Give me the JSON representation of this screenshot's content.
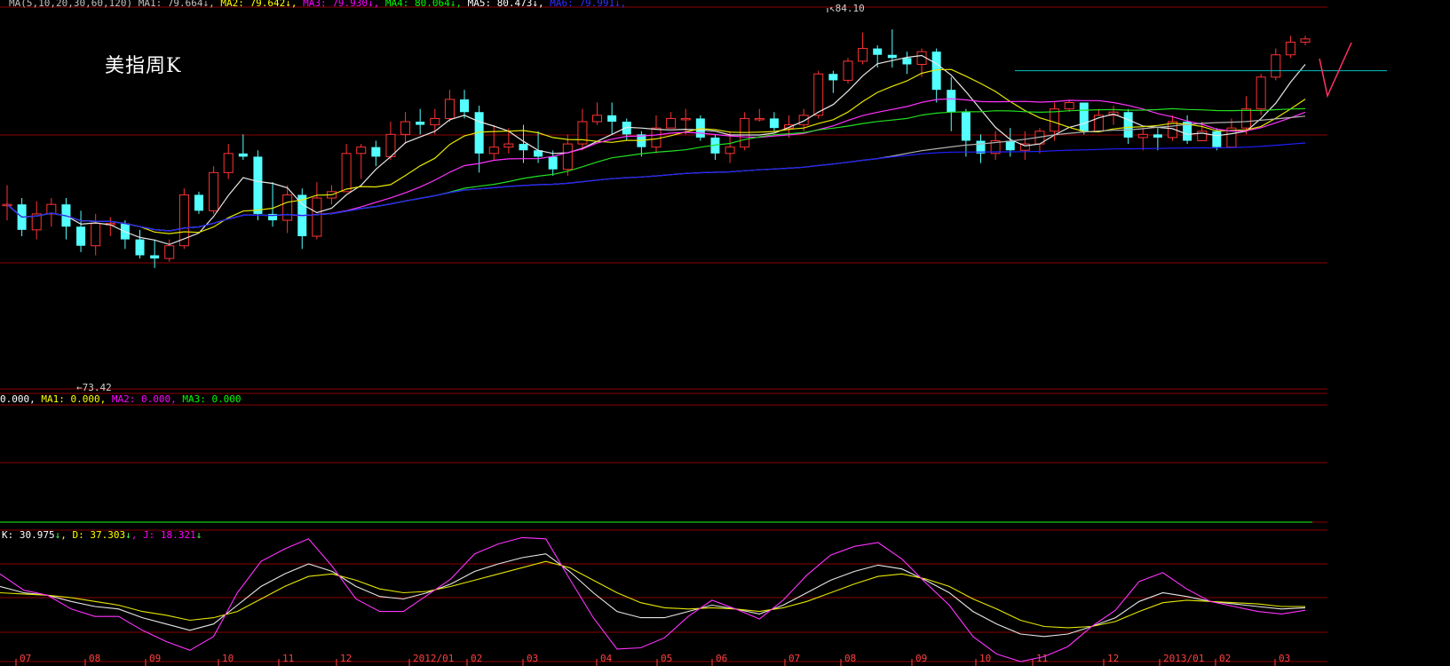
{
  "title": "美指周K",
  "price_panel_header": {
    "items": [
      {
        "label": "MA(5,10,20,30,60,120) MA1: ",
        "value": "79.664",
        "color": "#c0c0c0"
      },
      {
        "label": " MA2: ",
        "value": "79.642",
        "color": "#ffff00"
      },
      {
        "label": " MA3: ",
        "value": "79.930",
        "color": "#ff00ff"
      },
      {
        "label": " MA4: ",
        "value": "80.064",
        "color": "#00ff00"
      },
      {
        "label": " MA5: ",
        "value": "80.473",
        "color": "#ffffff"
      },
      {
        "label": " MA6: ",
        "value": "79.991",
        "color": "#3030ff"
      }
    ]
  },
  "volume_panel_header": {
    "prefix": "0.000, ",
    "ma1": "MA1: 0.000, ",
    "ma2": "MA2: 0.000, ",
    "ma3": "MA3: 0.000"
  },
  "kdj_panel_header": {
    "k": "K: 30.975",
    "d": "D: 37.303",
    "j": "J: 18.321",
    "arrow": "↓"
  },
  "annotations": {
    "high": "84.10",
    "low": "73.42"
  },
  "x_ticks": [
    "07",
    "08",
    "09",
    "10",
    "11",
    "12",
    "2012/01",
    "02",
    "03",
    "04",
    "05",
    "06",
    "07",
    "08",
    "09",
    "10",
    "11",
    "12",
    "2013/01",
    "02",
    "03"
  ],
  "colors": {
    "background": "#000000",
    "up": "#ff3333",
    "down": "#54ffff",
    "grid": "#8b0000",
    "ma_white": "#e6e6e6",
    "ma_yellow": "#e6e600",
    "ma_magenta": "#ff33ff",
    "ma_green": "#22dd22",
    "ma_gray": "#b0b0b0",
    "ma_blue": "#2020ff",
    "resistance": "#00c0c0"
  },
  "chart_data": {
    "type": "candlestick",
    "interval": "weekly",
    "ylim": [
      72.8,
      84.8
    ],
    "candles": [
      [
        78.6,
        78.6,
        79.2,
        78.1
      ],
      [
        78.6,
        77.8,
        78.8,
        77.6
      ],
      [
        77.8,
        78.3,
        78.7,
        77.5
      ],
      [
        78.3,
        78.6,
        78.8,
        77.9
      ],
      [
        78.6,
        77.9,
        78.8,
        77.5
      ],
      [
        77.9,
        77.3,
        78.4,
        77.1
      ],
      [
        77.3,
        78.0,
        78.3,
        77.0
      ],
      [
        78.0,
        78.0,
        78.2,
        77.6
      ],
      [
        78.0,
        77.5,
        78.1,
        77.2
      ],
      [
        77.5,
        77.0,
        77.8,
        76.9
      ],
      [
        77.0,
        76.9,
        77.5,
        76.6
      ],
      [
        76.9,
        77.3,
        77.5,
        76.8
      ],
      [
        77.3,
        78.9,
        79.1,
        77.2
      ],
      [
        78.9,
        78.4,
        79.0,
        78.3
      ],
      [
        78.4,
        79.6,
        79.8,
        78.3
      ],
      [
        79.6,
        80.2,
        80.5,
        79.4
      ],
      [
        80.2,
        80.1,
        80.8,
        80.0
      ],
      [
        80.1,
        78.3,
        80.3,
        78.1
      ],
      [
        78.3,
        78.1,
        79.3,
        77.9
      ],
      [
        78.1,
        78.9,
        79.2,
        77.7
      ],
      [
        78.9,
        77.6,
        79.1,
        77.2
      ],
      [
        77.6,
        78.8,
        79.3,
        77.5
      ],
      [
        78.8,
        79.0,
        79.2,
        78.6
      ],
      [
        79.0,
        80.2,
        80.5,
        79.1
      ],
      [
        80.2,
        80.4,
        80.5,
        79.4
      ],
      [
        80.4,
        80.1,
        80.6,
        79.8
      ],
      [
        80.1,
        80.8,
        81.2,
        80.0
      ],
      [
        80.8,
        81.2,
        81.5,
        80.5
      ],
      [
        81.2,
        81.1,
        81.6,
        80.8
      ],
      [
        81.1,
        81.3,
        81.6,
        80.8
      ],
      [
        81.3,
        81.9,
        82.2,
        81.2
      ],
      [
        81.9,
        81.5,
        82.2,
        81.3
      ],
      [
        81.5,
        80.2,
        81.7,
        79.6
      ],
      [
        80.2,
        80.4,
        81.1,
        80.0
      ],
      [
        80.4,
        80.5,
        81.0,
        80.2
      ],
      [
        80.5,
        80.3,
        81.1,
        79.9
      ],
      [
        80.3,
        80.1,
        80.9,
        79.9
      ],
      [
        80.1,
        79.7,
        80.3,
        79.5
      ],
      [
        79.7,
        80.5,
        80.8,
        79.5
      ],
      [
        80.5,
        81.2,
        81.6,
        80.3
      ],
      [
        81.2,
        81.4,
        81.8,
        81.1
      ],
      [
        81.4,
        81.2,
        81.8,
        80.8
      ],
      [
        81.2,
        80.8,
        81.3,
        80.6
      ],
      [
        80.8,
        80.4,
        80.9,
        80.1
      ],
      [
        80.4,
        81.0,
        81.4,
        80.2
      ],
      [
        81.0,
        81.3,
        81.5,
        81.0
      ],
      [
        81.3,
        81.3,
        81.6,
        80.8
      ],
      [
        81.3,
        80.7,
        81.4,
        80.6
      ],
      [
        80.7,
        80.2,
        80.8,
        80.0
      ],
      [
        80.2,
        80.4,
        80.9,
        79.9
      ],
      [
        80.4,
        81.3,
        81.5,
        80.3
      ],
      [
        81.3,
        81.3,
        81.6,
        81.2
      ],
      [
        81.3,
        81.0,
        81.5,
        80.9
      ],
      [
        81.0,
        81.1,
        81.4,
        80.7
      ],
      [
        81.1,
        81.4,
        81.6,
        80.9
      ],
      [
        81.4,
        82.7,
        82.8,
        81.3
      ],
      [
        82.7,
        82.5,
        82.8,
        82.1
      ],
      [
        82.5,
        83.1,
        83.2,
        82.4
      ],
      [
        83.1,
        83.5,
        84.0,
        83.0
      ],
      [
        83.5,
        83.3,
        83.6,
        82.9
      ],
      [
        83.3,
        83.2,
        84.1,
        82.9
      ],
      [
        83.2,
        83.0,
        83.4,
        82.7
      ],
      [
        83.0,
        83.4,
        83.5,
        82.6
      ],
      [
        83.4,
        82.2,
        83.5,
        81.8
      ],
      [
        82.2,
        81.5,
        82.6,
        80.9
      ],
      [
        81.5,
        80.6,
        81.6,
        80.1
      ],
      [
        80.6,
        80.2,
        80.8,
        79.9
      ],
      [
        80.2,
        80.6,
        80.9,
        80.0
      ],
      [
        80.6,
        80.3,
        81.0,
        80.1
      ],
      [
        80.3,
        80.5,
        80.9,
        80.0
      ],
      [
        80.5,
        80.9,
        81.0,
        80.2
      ],
      [
        80.9,
        81.6,
        81.8,
        80.6
      ],
      [
        81.6,
        81.8,
        81.9,
        81.5
      ],
      [
        81.8,
        80.9,
        81.8,
        80.8
      ],
      [
        80.9,
        81.4,
        81.6,
        80.9
      ],
      [
        81.4,
        81.5,
        81.7,
        81.1
      ],
      [
        81.5,
        80.7,
        81.6,
        80.5
      ],
      [
        80.7,
        80.8,
        81.0,
        80.3
      ],
      [
        80.8,
        80.7,
        81.0,
        80.3
      ],
      [
        80.7,
        81.2,
        81.4,
        80.6
      ],
      [
        81.2,
        80.6,
        81.4,
        80.5
      ],
      [
        80.6,
        80.9,
        81.2,
        80.8
      ],
      [
        80.9,
        80.4,
        81.0,
        80.3
      ],
      [
        80.4,
        81.0,
        81.3,
        80.4
      ],
      [
        81.0,
        81.6,
        82.0,
        80.8
      ],
      [
        81.6,
        82.6,
        82.7,
        81.4
      ],
      [
        82.6,
        83.3,
        83.5,
        82.5
      ],
      [
        83.3,
        83.7,
        83.9,
        83.2
      ],
      [
        83.7,
        83.8,
        83.9,
        83.6
      ]
    ],
    "resistance_level": 82.8,
    "kdj": {
      "k": [
        60,
        55,
        53,
        48,
        44,
        42,
        35,
        30,
        25,
        30,
        45,
        60,
        70,
        78,
        72,
        60,
        52,
        50,
        55,
        62,
        72,
        78,
        83,
        86,
        72,
        55,
        40,
        35,
        35,
        40,
        45,
        42,
        38,
        45,
        55,
        65,
        72,
        77,
        74,
        65,
        55,
        40,
        30,
        22,
        20,
        22,
        28,
        35,
        48,
        55,
        52,
        48,
        46,
        44,
        42,
        43
      ],
      "d": [
        55,
        54,
        53,
        51,
        48,
        45,
        40,
        37,
        33,
        35,
        40,
        50,
        60,
        68,
        70,
        65,
        58,
        55,
        56,
        60,
        65,
        70,
        75,
        80,
        75,
        65,
        55,
        47,
        43,
        42,
        43,
        42,
        40,
        43,
        48,
        55,
        62,
        68,
        70,
        66,
        60,
        50,
        42,
        33,
        28,
        27,
        28,
        32,
        40,
        47,
        49,
        48,
        47,
        46,
        44,
        44
      ],
      "j": [
        70,
        57,
        53,
        42,
        36,
        36,
        25,
        16,
        9,
        20,
        55,
        80,
        90,
        98,
        76,
        50,
        40,
        40,
        53,
        66,
        86,
        94,
        99,
        98,
        66,
        35,
        10,
        11,
        19,
        36,
        49,
        42,
        34,
        49,
        69,
        85,
        92,
        95,
        82,
        63,
        45,
        20,
        6,
        0,
        4,
        12,
        28,
        41,
        64,
        71,
        58,
        48,
        44,
        40,
        38,
        41
      ]
    }
  }
}
